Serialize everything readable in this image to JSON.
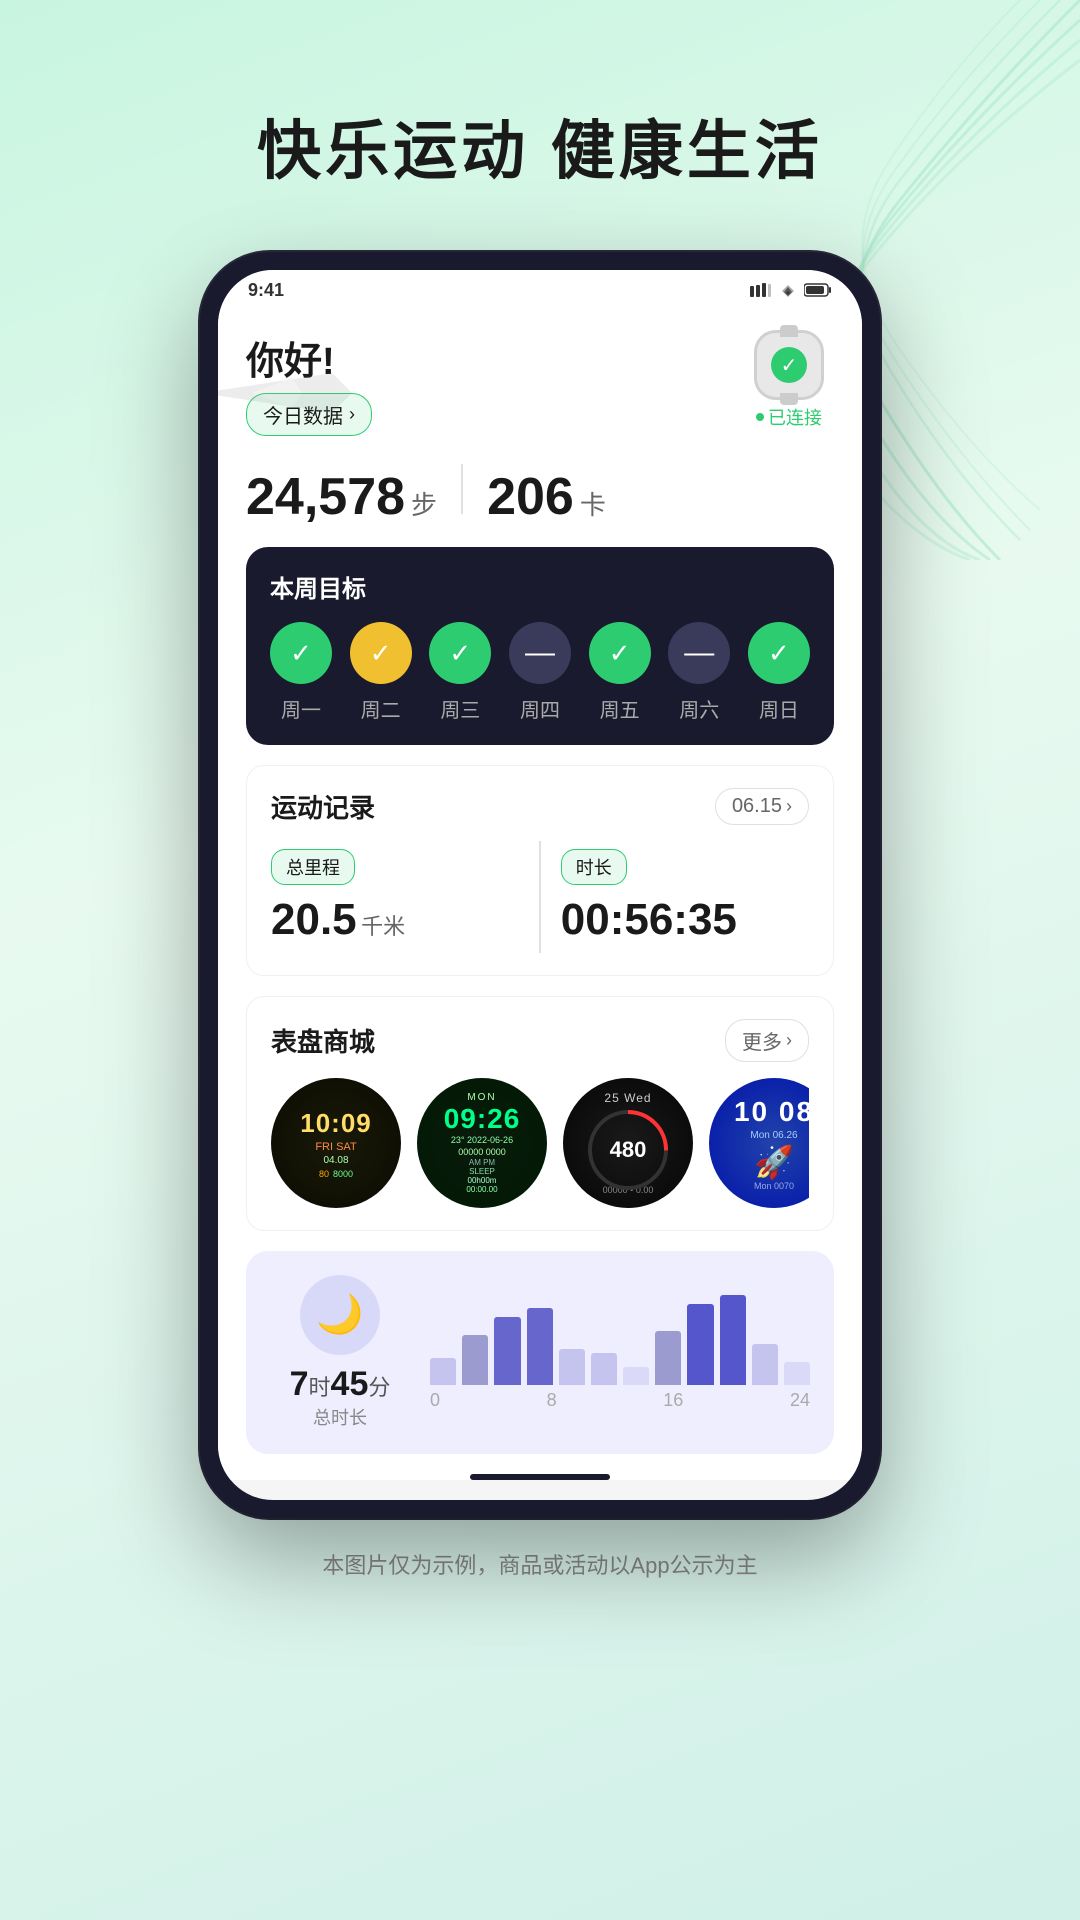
{
  "page": {
    "background_color": "#c8f5e0",
    "hero_title": "快乐运动 健康生活",
    "footer_text": "本图片仅为示例，商品或活动以App公示为主"
  },
  "app": {
    "greeting": "你好!",
    "today_data_btn": "今日数据",
    "connected_label": "已连接",
    "steps_number": "24,578",
    "steps_unit": "步",
    "calories_number": "206",
    "calories_unit": "卡",
    "weekly_goals": {
      "title": "本周目标",
      "days": [
        {
          "label": "周一",
          "status": "green"
        },
        {
          "label": "周二",
          "status": "yellow"
        },
        {
          "label": "周三",
          "status": "green"
        },
        {
          "label": "周四",
          "status": "dark"
        },
        {
          "label": "周五",
          "status": "green"
        },
        {
          "label": "周六",
          "status": "dark"
        },
        {
          "label": "周日",
          "status": "green"
        }
      ]
    },
    "exercise_record": {
      "title": "运动记录",
      "date": "06.15",
      "distance_label": "总里程",
      "distance_value": "20.5",
      "distance_unit": "千米",
      "duration_label": "时长",
      "duration_value": "00:56:35"
    },
    "watch_store": {
      "title": "表盘商城",
      "more_btn": "更多",
      "faces": [
        {
          "id": "wf1",
          "time": "10:09",
          "sub": "FRI SAT"
        },
        {
          "id": "wf2",
          "time": "09:26",
          "sub": "MON 2022-06-26"
        },
        {
          "id": "wf3",
          "time": "25 Wed",
          "sub": ""
        },
        {
          "id": "wf4",
          "time": "10 08",
          "sub": "Mon 0070"
        }
      ]
    },
    "sleep": {
      "icon": "🌙",
      "duration_hours": "7",
      "duration_hours_unit": "时",
      "duration_minutes": "45",
      "duration_minutes_unit": "分",
      "total_label": "总时长",
      "axis_labels": [
        "0",
        "8",
        "16",
        "24"
      ]
    }
  }
}
